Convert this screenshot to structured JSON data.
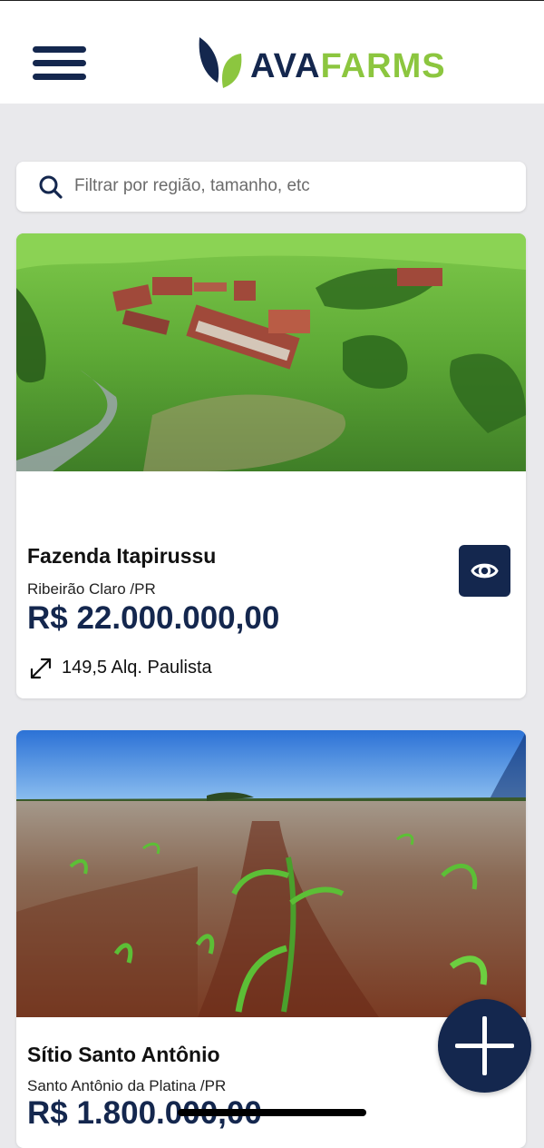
{
  "header": {
    "logo_part1": "AVA",
    "logo_part2": "FARMS"
  },
  "search": {
    "placeholder": "Filtrar por região, tamanho, etc",
    "value": ""
  },
  "listings": [
    {
      "title": "Fazenda Itapirussu",
      "location": "Ribeirão Claro /PR",
      "price": "R$ 22.000.000,00",
      "area": "149,5 Alq. Paulista"
    },
    {
      "title": "Sítio Santo Antônio",
      "location": "Santo Antônio da Platina /PR",
      "price": "R$ 1.800.000,00"
    }
  ],
  "icons": {
    "menu": "hamburger-menu-icon",
    "search": "search-icon",
    "view": "eye-icon",
    "area": "diagonal-arrows-icon",
    "add": "plus-icon"
  },
  "colors": {
    "brand_navy": "#14274e",
    "brand_green": "#8cc63f",
    "background": "#e9e9ec"
  }
}
